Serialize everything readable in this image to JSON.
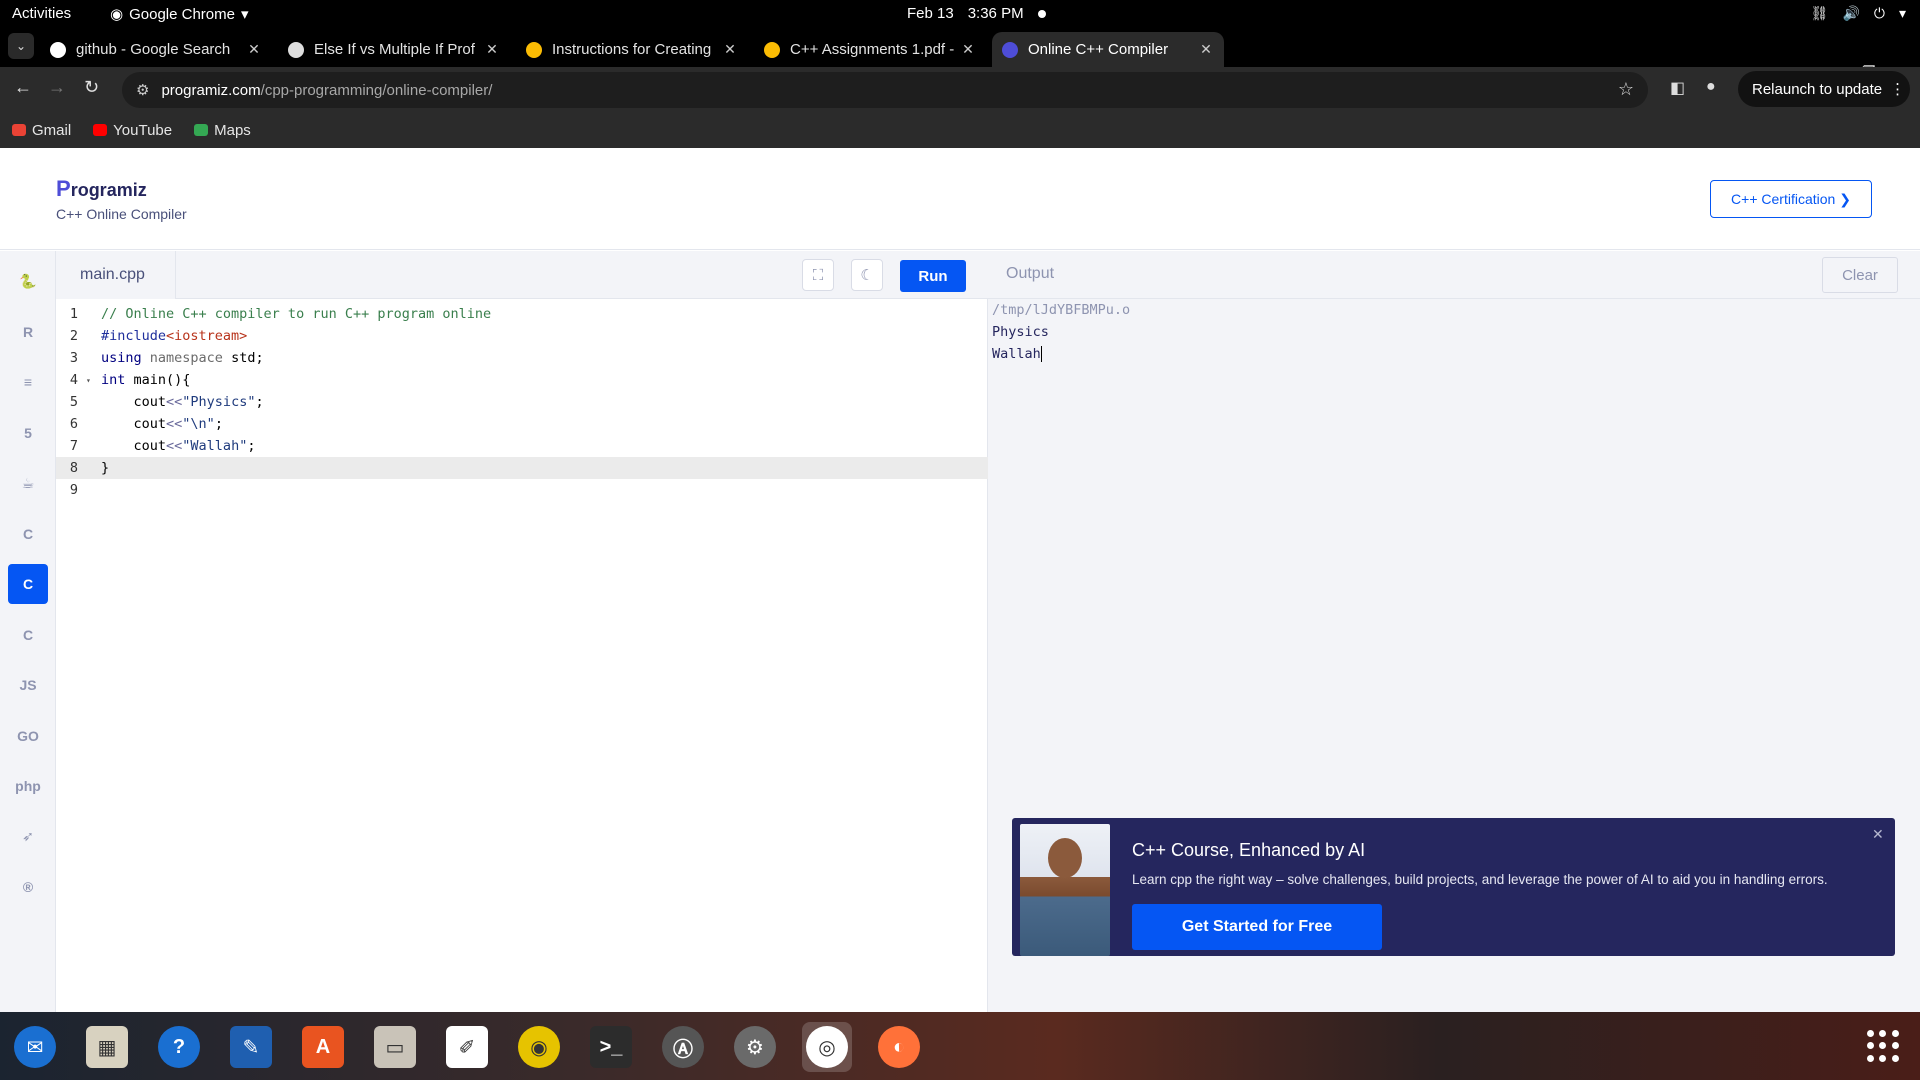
{
  "system": {
    "activities": "Activities",
    "app_name": "Google Chrome",
    "date": "Feb 13",
    "time": "3:36 PM"
  },
  "tabs": [
    {
      "title": "github - Google Search",
      "favicon": "google-icon",
      "active": false
    },
    {
      "title": "Else If vs Multiple If Prof",
      "favicon": "wordpress-icon",
      "active": false
    },
    {
      "title": "Instructions for Creating",
      "favicon": "drive-icon",
      "active": false
    },
    {
      "title": "C++ Assignments 1.pdf -",
      "favicon": "drive-icon",
      "active": false
    },
    {
      "title": "Online C++ Compiler",
      "favicon": "programiz-icon",
      "active": true
    }
  ],
  "address": {
    "host": "programiz.com",
    "path": "/cpp-programming/online-compiler/"
  },
  "relaunch_label": "Relaunch to update",
  "bookmarks": [
    {
      "label": "Gmail",
      "color": "#ea4335"
    },
    {
      "label": "YouTube",
      "color": "#ff0000"
    },
    {
      "label": "Maps",
      "color": "#34a853"
    }
  ],
  "header": {
    "logo": "rogramiz",
    "logo_initial": "P",
    "subtitle": "C++ Online Compiler",
    "cert_button": "C++ Certification ❯"
  },
  "sidebar_langs": [
    {
      "name": "python-icon",
      "glyph": "🐍",
      "active": false
    },
    {
      "name": "r-icon",
      "glyph": "R",
      "active": false
    },
    {
      "name": "sql-icon",
      "glyph": "≡",
      "active": false
    },
    {
      "name": "html-icon",
      "glyph": "5",
      "active": false
    },
    {
      "name": "java-icon",
      "glyph": "☕",
      "active": false
    },
    {
      "name": "c-icon",
      "glyph": "C",
      "active": false
    },
    {
      "name": "cpp-icon",
      "glyph": "C",
      "active": true
    },
    {
      "name": "csharp-icon",
      "glyph": "C",
      "active": false
    },
    {
      "name": "js-icon",
      "glyph": "JS",
      "active": false
    },
    {
      "name": "go-icon",
      "glyph": "GO",
      "active": false
    },
    {
      "name": "php-icon",
      "glyph": "php",
      "active": false
    },
    {
      "name": "swift-icon",
      "glyph": "➶",
      "active": false
    },
    {
      "name": "rust-icon",
      "glyph": "®",
      "active": false
    }
  ],
  "editor": {
    "filename": "main.cpp",
    "run_label": "Run",
    "lines": [
      {
        "n": "1",
        "html": "<span class='c-comment'>// Online C++ compiler to run C++ program online</span>"
      },
      {
        "n": "2",
        "html": "<span class='c-inc'>#include</span><span class='c-lib'>&lt;iostream&gt;</span>"
      },
      {
        "n": "3",
        "html": "<span class='c-kw'>using</span> <span class='c-ns'>namespace</span> std;"
      },
      {
        "n": "4",
        "html": "<span class='c-kw'>int</span> main(){",
        "fold": true
      },
      {
        "n": "5",
        "html": "    cout<span class='c-op'>&lt;&lt;</span><span class='c-str'>\"Physics\"</span>;"
      },
      {
        "n": "6",
        "html": "    cout<span class='c-op'>&lt;&lt;</span><span class='c-str'>\"\\n\"</span>;"
      },
      {
        "n": "7",
        "html": "    cout<span class='c-op'>&lt;&lt;</span><span class='c-str'>\"Wallah\"</span>;"
      },
      {
        "n": "8",
        "html": "}",
        "highlight": true
      },
      {
        "n": "9",
        "html": ""
      }
    ]
  },
  "output": {
    "title": "Output",
    "clear_label": "Clear",
    "lines": [
      "/tmp/lJdYBFBMPu.o",
      "Physics",
      "Wallah"
    ]
  },
  "promo": {
    "title": "C++ Course, Enhanced by AI",
    "description": "Learn cpp the right way – solve challenges, build projects, and leverage the power of AI to aid you in handling errors.",
    "cta": "Get Started for Free",
    "close": "✕"
  },
  "dock": [
    {
      "name": "thunderbird-icon",
      "glyph": "✉",
      "bg": "#1a6fd1"
    },
    {
      "name": "sudoku-icon",
      "glyph": "▦",
      "bg": "#d8d2c0"
    },
    {
      "name": "help-icon",
      "glyph": "?",
      "bg": "#1a6fd1"
    },
    {
      "name": "writer-icon",
      "glyph": "✎",
      "bg": "#1f5fb0"
    },
    {
      "name": "app-center-icon",
      "glyph": "A",
      "bg": "#e95420"
    },
    {
      "name": "files-icon",
      "glyph": "▭",
      "bg": "#c9c3b8"
    },
    {
      "name": "text-editor-icon",
      "glyph": "✐",
      "bg": "#ffffff"
    },
    {
      "name": "rhythmbox-icon",
      "glyph": "◉",
      "bg": "#e6c300"
    },
    {
      "name": "terminal-icon",
      "glyph": ">_",
      "bg": "#2c2c2c"
    },
    {
      "name": "software-updater-icon",
      "glyph": "Ⓐ",
      "bg": "#555555"
    },
    {
      "name": "settings-icon",
      "glyph": "⚙",
      "bg": "#6a6a6a"
    },
    {
      "name": "chrome-icon",
      "glyph": "◎",
      "bg": "#ffffff",
      "active": true
    },
    {
      "name": "firefox-icon",
      "glyph": "◐",
      "bg": "#ff7139"
    }
  ]
}
